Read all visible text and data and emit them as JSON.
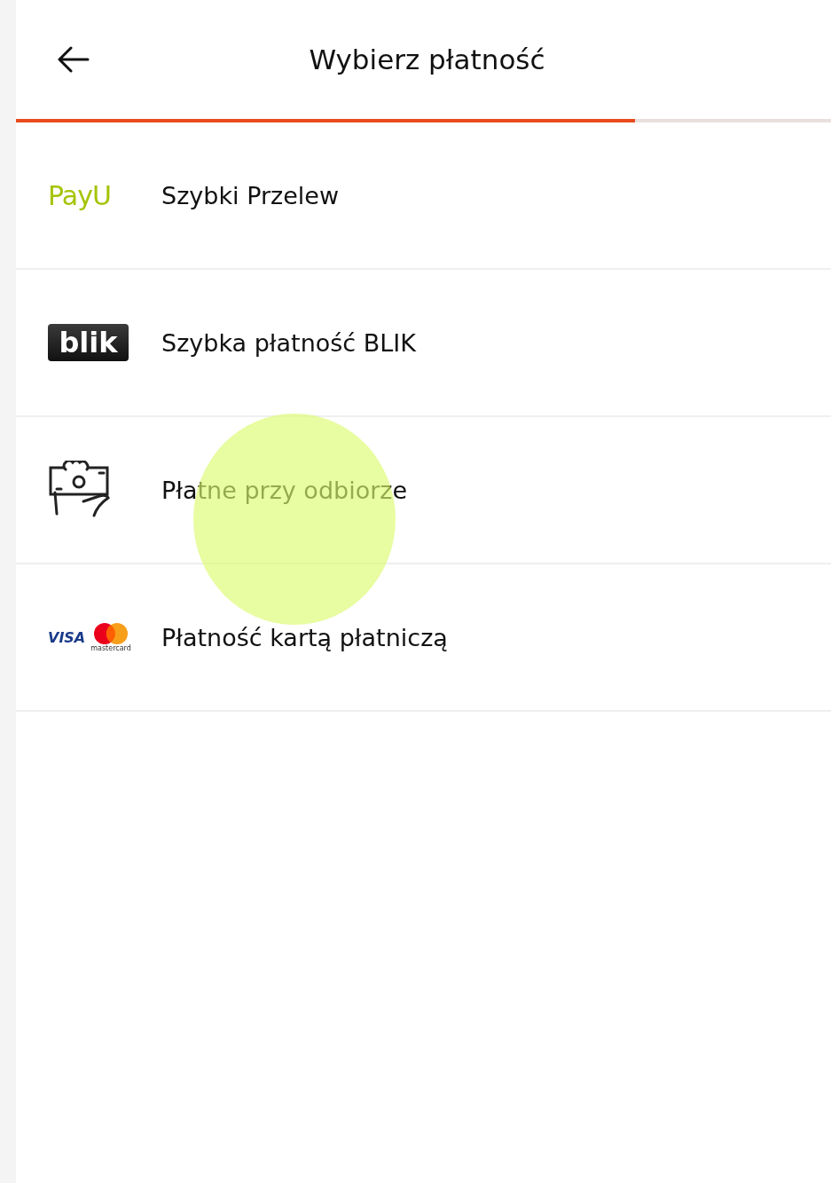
{
  "header": {
    "title": "Wybierz płatność"
  },
  "progress": {
    "level": 0.76
  },
  "methods": [
    {
      "kind": "payu",
      "label": "Szybki Przelew",
      "logo_text": "PayU",
      "touched": false
    },
    {
      "kind": "blik",
      "label": "Szybka płatność BLIK",
      "logo_text": "blik",
      "touched": false
    },
    {
      "kind": "cash",
      "label": "Płatne przy odbiorze",
      "touched": true
    },
    {
      "kind": "card",
      "label": "Płatność kartą płatniczą",
      "logo_text": "VISA",
      "logo_subtext": "mastercard",
      "touched": false
    }
  ]
}
